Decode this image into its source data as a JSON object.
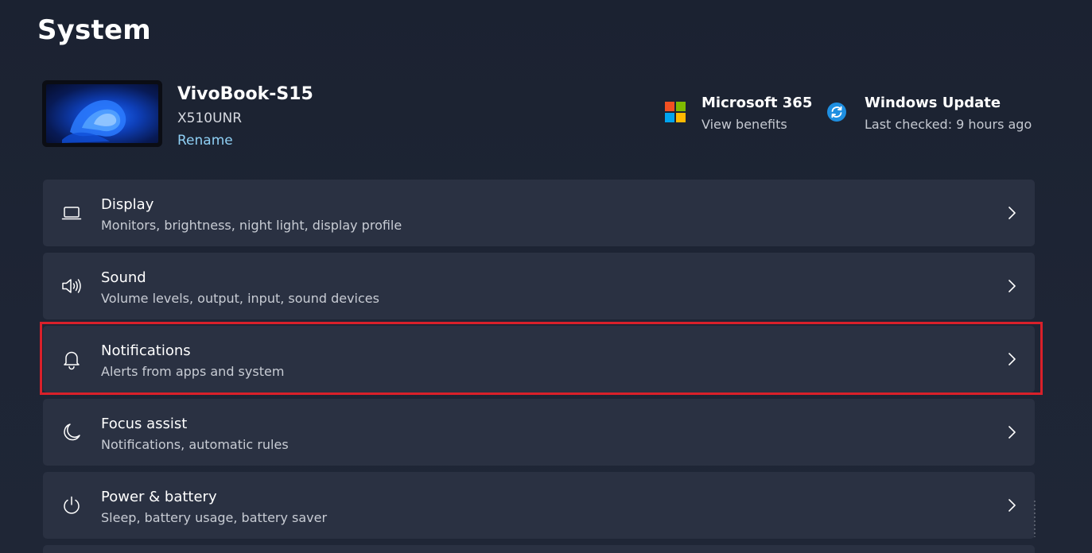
{
  "page": {
    "title": "System"
  },
  "device": {
    "name": "VivoBook-S15",
    "model": "X510UNR",
    "rename_label": "Rename"
  },
  "quick_links": {
    "microsoft365": {
      "title": "Microsoft 365",
      "subtitle": "View benefits",
      "icon": "microsoft-logo-icon"
    },
    "windows_update": {
      "title": "Windows Update",
      "subtitle": "Last checked: 9 hours ago",
      "icon": "sync-icon"
    }
  },
  "settings": [
    {
      "title": "Display",
      "subtitle": "Monitors, brightness, night light, display profile",
      "icon": "laptop-icon"
    },
    {
      "title": "Sound",
      "subtitle": "Volume levels, output, input, sound devices",
      "icon": "speaker-icon"
    },
    {
      "title": "Notifications",
      "subtitle": "Alerts from apps and system",
      "icon": "bell-icon",
      "highlighted": true
    },
    {
      "title": "Focus assist",
      "subtitle": "Notifications, automatic rules",
      "icon": "moon-icon"
    },
    {
      "title": "Power & battery",
      "subtitle": "Sleep, battery usage, battery saver",
      "icon": "power-icon"
    }
  ],
  "colors": {
    "background": "#1c2333",
    "card": "#2a3142",
    "accent_link": "#8fd0f5",
    "highlight_border": "#d9202a",
    "ms_red": "#f25022",
    "ms_green": "#7fba00",
    "ms_blue": "#00a4ef",
    "ms_yellow": "#ffb900",
    "update_blue": "#1e8fe1"
  }
}
